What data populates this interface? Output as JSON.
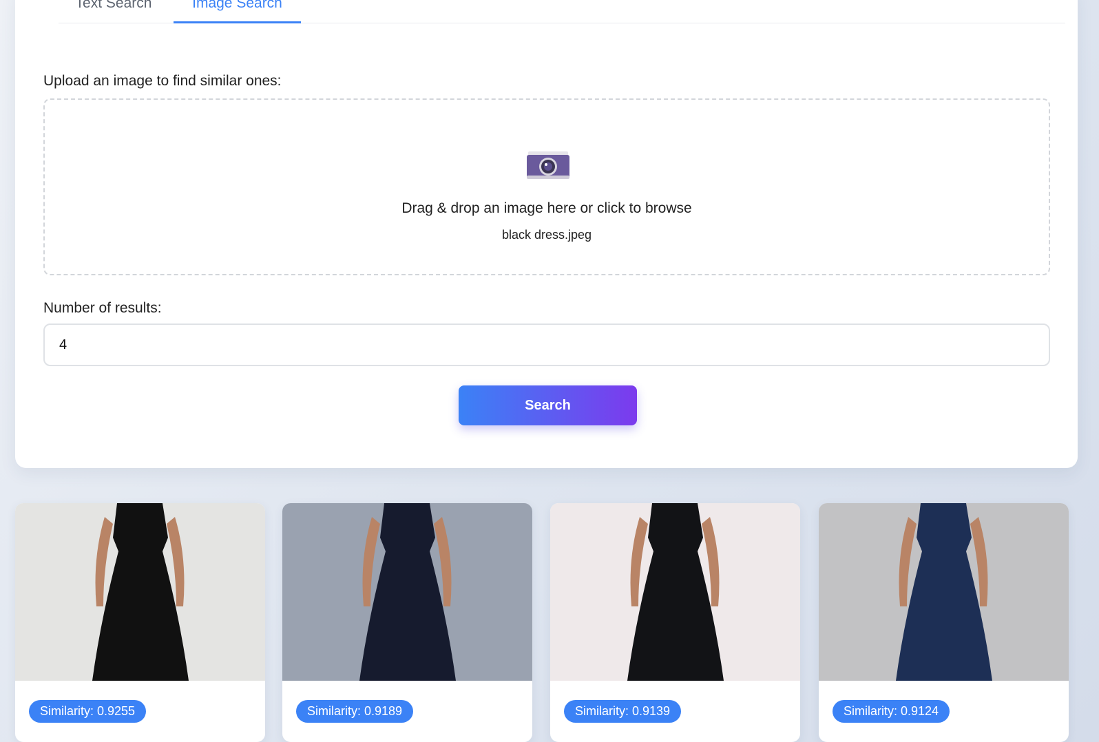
{
  "tabs": [
    {
      "label": "Text Search",
      "active": false
    },
    {
      "label": "Image Search",
      "active": true
    }
  ],
  "upload": {
    "label": "Upload an image to find similar ones:",
    "prompt": "Drag & drop an image here or click to browse",
    "filename": "black dress.jpeg",
    "icon": "camera-icon"
  },
  "results_count": {
    "label": "Number of results:",
    "value": "4"
  },
  "search_button": {
    "label": "Search"
  },
  "results": [
    {
      "similarity": "Similarity: 0.9255",
      "dress_color": "#111111",
      "bg_color": "#e4e4e2"
    },
    {
      "similarity": "Similarity: 0.9189",
      "dress_color": "#161b2e",
      "bg_color": "#9aa2b0"
    },
    {
      "similarity": "Similarity: 0.9139",
      "dress_color": "#121316",
      "bg_color": "#efe9ea"
    },
    {
      "similarity": "Similarity: 0.9124",
      "dress_color": "#1d2f55",
      "bg_color": "#c2c2c4"
    }
  ],
  "colors": {
    "accent": "#3b82f6",
    "gradient_end": "#7c3aed"
  }
}
